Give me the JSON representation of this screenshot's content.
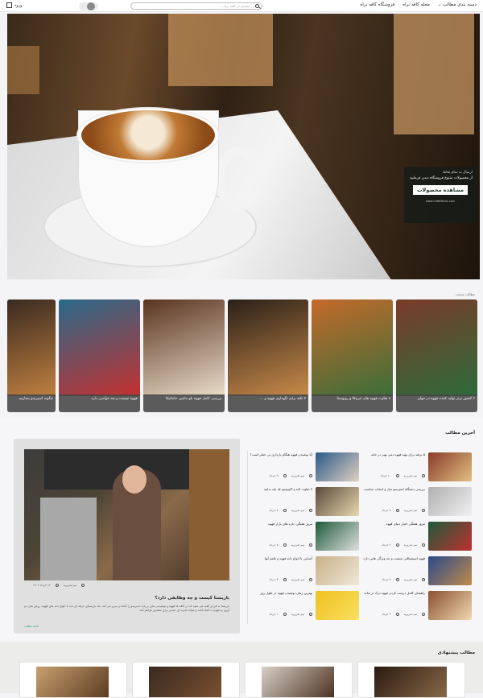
{
  "header": {
    "nav": [
      "فروشگاه کافه نراه",
      "مجله کافه نراه",
      "دسته بندی مطالب"
    ],
    "search_placeholder": "جستجو در کافه نراه...",
    "login_label": "ورود"
  },
  "hero": {
    "promo_line1": "ارسال به تمام نقاط",
    "promo_line2": "از محصولات متنوع فروشگاه دیدن فرمایید",
    "promo_button": "مشاهده محصولات",
    "promo_url": "www.CafeNeraa.com"
  },
  "featured_strip": {
    "title": "مطالب منتخب",
    "cards": [
      {
        "caption": "۶ کشور برتر تولید کننده قهوه در جهان",
        "colors": [
          "#7a3b2a",
          "#2d6b3a"
        ]
      },
      {
        "caption": "۸ تفاوت قهوه های عربیکا و روبوستا",
        "colors": [
          "#c46a2a",
          "#3a6e3a"
        ]
      },
      {
        "caption": "۴ نکته برای نگهداری قهوه و ...",
        "colors": [
          "#2a2018",
          "#c98a4a"
        ]
      },
      {
        "caption": "بررسی کامل قهوه بلو مانتین جامائیکا",
        "colors": [
          "#5a3420",
          "#e8dcc8"
        ]
      },
      {
        "caption": "قهوه چیست و چه خواصی دارد",
        "colors": [
          "#2a6a8a",
          "#c43030"
        ]
      },
      {
        "caption": "چگونه اسپرسو بسازیم",
        "colors": [
          "#3a2a20",
          "#c08040"
        ]
      }
    ]
  },
  "latest": {
    "title": "آخرین مطالب",
    "feature": {
      "title": "باریستا کیست و چه وظایفی دارد؟",
      "excerpt": "باریستا به فردی گفته می شود که در کافه ها قهوه و نوشیدنی های بر پایه اسپرسو را آماده و سرو می کند. یک باریستای حرفه ای باید با انواع دانه های قهوه، روش های دم آوری و تجهیزات آشنا باشد و بتواند تجربه ای دلپذیر برای مشتری فراهم کند.",
      "more": "ادامه مطلب",
      "author": "تیم تحریریه",
      "date": "۱۲ خرداد ۱۴۰۲"
    },
    "items": [
      {
        "title": "۵ ترفند برای تهیه قهوه دمی بهتر در خانه",
        "author": "تیم تحریریه",
        "date": "۱۰ خرداد",
        "colors": [
          "#8a3a2a",
          "#e0c080"
        ]
      },
      {
        "title": "آیا نوشیدن قهوه هنگام بارداری بی خطر است؟",
        "author": "تیم تحریریه",
        "date": "۹ خرداد",
        "colors": [
          "#2a5a8a",
          "#e0d0c0"
        ]
      },
      {
        "title": "بررسی دستگاه اسپرسو ساز و انتخاب مناسب",
        "author": "تیم تحریریه",
        "date": "۸ خرداد",
        "colors": [
          "#b0b0b0",
          "#f0f0f0"
        ]
      },
      {
        "title": "۷ تفاوت لاته و کاپوچینو که باید بدانید",
        "author": "تیم تحریریه",
        "date": "۷ خرداد",
        "colors": [
          "#5a4a3a",
          "#e8d8b0"
        ]
      },
      {
        "title": "مرور هفتگی اخبار دنیای قهوه",
        "author": "تیم تحریریه",
        "date": "۶ خرداد",
        "colors": [
          "#1e5a3a",
          "#c03030"
        ]
      },
      {
        "title": "مرور هفتگی: تازه های بازار قهوه",
        "author": "تیم تحریریه",
        "date": "۵ خرداد",
        "colors": [
          "#1e5a3a",
          "#e0e0e0"
        ]
      },
      {
        "title": "قهوه اسپشیالتی چیست و چه ویژگی هایی دارد",
        "author": "تیم تحریریه",
        "date": "۴ خرداد",
        "colors": [
          "#2a4a8a",
          "#c08a4a"
        ]
      },
      {
        "title": "آشنایی با انواع دانه قهوه و طعم آنها",
        "author": "تیم تحریریه",
        "date": "۳ خرداد",
        "colors": [
          "#c8b088",
          "#f0e8d8"
        ]
      },
      {
        "title": "راهنمای کامل درست کردن قهوه ترک در خانه",
        "author": "تیم تحریریه",
        "date": "۲ خرداد",
        "colors": [
          "#8a5030",
          "#f0d8b0"
        ]
      },
      {
        "title": "بهترین زمان نوشیدن قهوه در طول روز",
        "author": "تیم تحریریه",
        "date": "۱ خرداد",
        "colors": [
          "#f0c020",
          "#f8e060"
        ]
      }
    ]
  },
  "suggested": {
    "title": "مطالب پیشنهادی",
    "cards": [
      {
        "colors": [
          "#c8a070",
          "#5a3a20"
        ]
      },
      {
        "colors": [
          "#3a2a20",
          "#7a5030"
        ]
      },
      {
        "colors": [
          "#d8d0c8",
          "#4a3020"
        ]
      },
      {
        "colors": [
          "#2a1a10",
          "#8a6a4a"
        ]
      }
    ]
  }
}
